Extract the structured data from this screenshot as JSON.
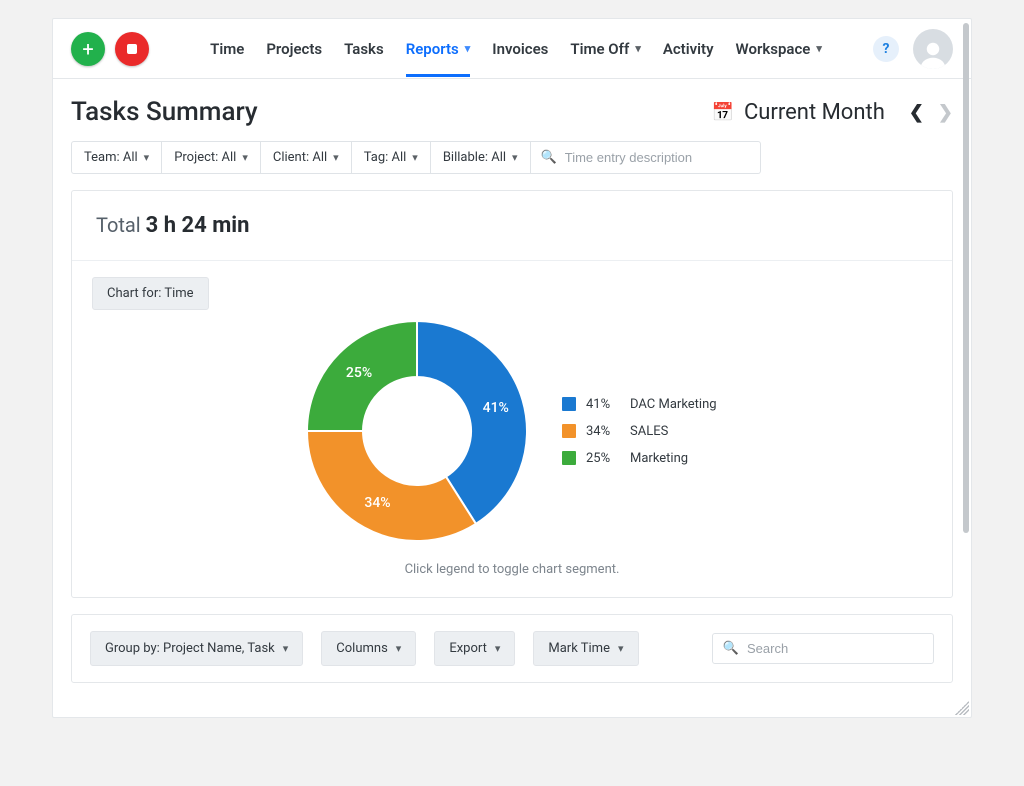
{
  "nav": {
    "items": [
      {
        "label": "Time",
        "has_chev": false,
        "active": false
      },
      {
        "label": "Projects",
        "has_chev": false,
        "active": false
      },
      {
        "label": "Tasks",
        "has_chev": false,
        "active": false
      },
      {
        "label": "Reports",
        "has_chev": true,
        "active": true
      },
      {
        "label": "Invoices",
        "has_chev": false,
        "active": false
      },
      {
        "label": "Time Off",
        "has_chev": true,
        "active": false
      },
      {
        "label": "Activity",
        "has_chev": false,
        "active": false
      },
      {
        "label": "Workspace",
        "has_chev": true,
        "active": false
      }
    ]
  },
  "page": {
    "title": "Tasks Summary",
    "date_range": "Current Month"
  },
  "filters": {
    "team_label": "Team: All",
    "project_label": "Project: All",
    "client_label": "Client: All",
    "tag_label": "Tag: All",
    "billable_label": "Billable: All",
    "search_placeholder": "Time entry description"
  },
  "total": {
    "label": "Total",
    "value": "3 h 24 min"
  },
  "chart_toggle_label": "Chart for: Time",
  "chart_note": "Click legend to toggle chart segment.",
  "actions": {
    "group_by": "Group by: Project Name, Task",
    "columns": "Columns",
    "export": "Export",
    "mark_time": "Mark Time",
    "search_placeholder": "Search"
  },
  "colors": {
    "blue": "#1a79d1",
    "orange": "#f2922a",
    "green": "#3cab3c"
  },
  "chart_data": {
    "type": "pie",
    "title": "Chart for: Time",
    "series": [
      {
        "name": "DAC Marketing",
        "value": 41,
        "color": "blue",
        "pct_label": "41%"
      },
      {
        "name": "SALES",
        "value": 34,
        "color": "orange",
        "pct_label": "34%"
      },
      {
        "name": "Marketing",
        "value": 25,
        "color": "green",
        "pct_label": "25%"
      }
    ],
    "unit": "percent",
    "note": "Click legend to toggle chart segment."
  }
}
